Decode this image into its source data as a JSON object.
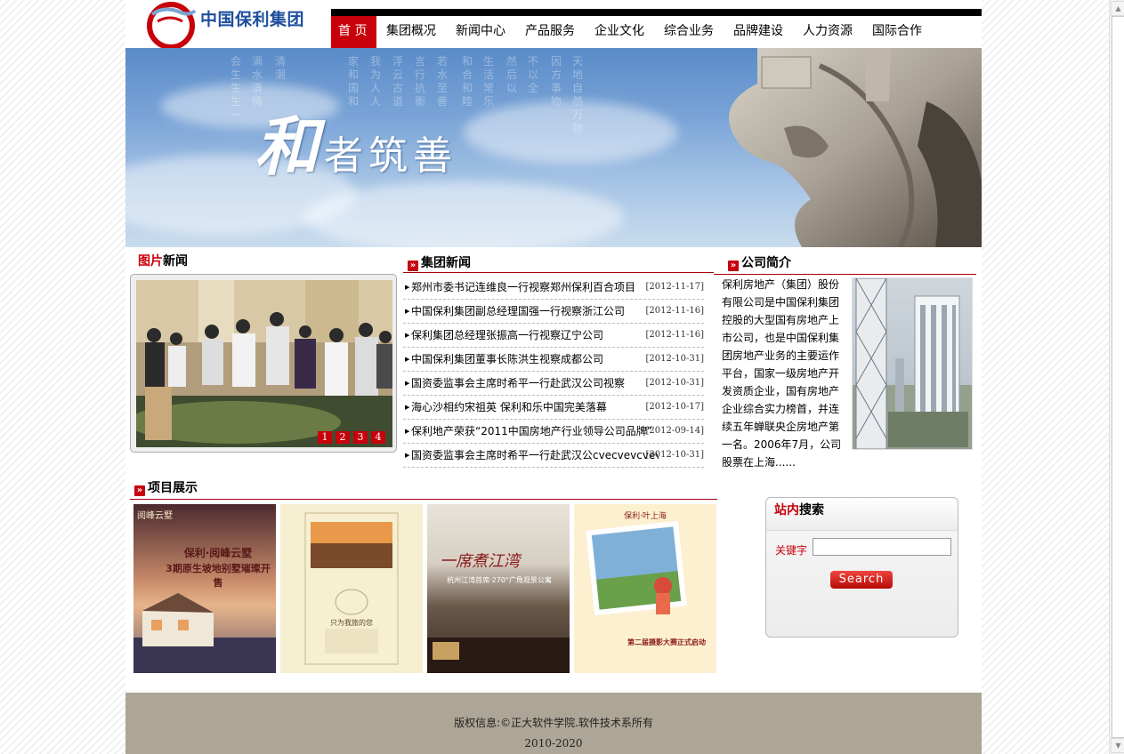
{
  "header": {
    "logo_text": "中国保利集团",
    "nav": [
      {
        "label": "首 页",
        "active": true
      },
      {
        "label": "集团概况"
      },
      {
        "label": "新闻中心"
      },
      {
        "label": "产品服务"
      },
      {
        "label": "企业文化"
      },
      {
        "label": "综合业务"
      },
      {
        "label": "品牌建设"
      },
      {
        "label": "人力资源"
      },
      {
        "label": "国际合作"
      }
    ]
  },
  "banner": {
    "slogan_big": "和",
    "slogan_rest": "者筑善"
  },
  "photo_news": {
    "title_red": "图片",
    "title_black": "新闻",
    "slides": [
      "1",
      "2",
      "3",
      "4"
    ]
  },
  "group_news": {
    "title": "集团新闻",
    "items": [
      {
        "title": "郑州市委书记连维良一行视察郑州保利百合项目",
        "date": "[2012-11-17]"
      },
      {
        "title": "中国保利集团副总经理国强一行视察浙江公司",
        "date": "[2012-11-16]"
      },
      {
        "title": "保利集团总经理张振高一行视察辽宁公司",
        "date": "[2012-11-16]"
      },
      {
        "title": "中国保利集团董事长陈洪生视察成都公司",
        "date": "[2012-10-31]"
      },
      {
        "title": "国资委监事会主席时希平一行赴武汉公司视察",
        "date": "[2012-10-31]"
      },
      {
        "title": "海心沙相约宋祖英 保利和乐中国完美落幕",
        "date": "[2012-10-17]"
      },
      {
        "title": "保利地产荣获“2011中国房地产行业领导公司品牌”",
        "date": "[2012-09-14]"
      },
      {
        "title": "国资委监事会主席时希平一行赴武汉公cvecvevcvevcvev",
        "date": "[2012-10-31]"
      }
    ]
  },
  "company_profile": {
    "title": "公司简介",
    "text": "保利房地产（集团）股份有限公司是中国保利集团控股的大型国有房地产上市公司，也是中国保利集团房地产业务的主要运作平台，国家一级房地产开发资质企业，国有房地产企业综合实力榜首，并连续五年蝉联央企房地产第一名。2006年7月，公司股票在上海......"
  },
  "projects": {
    "title": "项目展示",
    "posters": [
      {
        "caption": "阅峰云墅",
        "headline": "保利·阅峰云墅",
        "sub": "3期原生坡地别墅璀璨开售"
      },
      {
        "caption": "只为我旅的您"
      },
      {
        "caption": "一席煮江湾",
        "sub": "杭州江湾首席·270°广角观景公寓"
      },
      {
        "caption": "保利·叶上海",
        "sub": "第二届摄影大赛正式启动"
      }
    ]
  },
  "search": {
    "title_red": "站内",
    "title_black": "搜索",
    "label": "关键字",
    "placeholder": "",
    "button": "Search"
  },
  "footer": {
    "copyright": "版权信息:©正大软件学院.软件技术系所有",
    "years": "2010-2020"
  },
  "colors": {
    "accent_red": "#c8000b",
    "footer_bg": "#ada595"
  }
}
